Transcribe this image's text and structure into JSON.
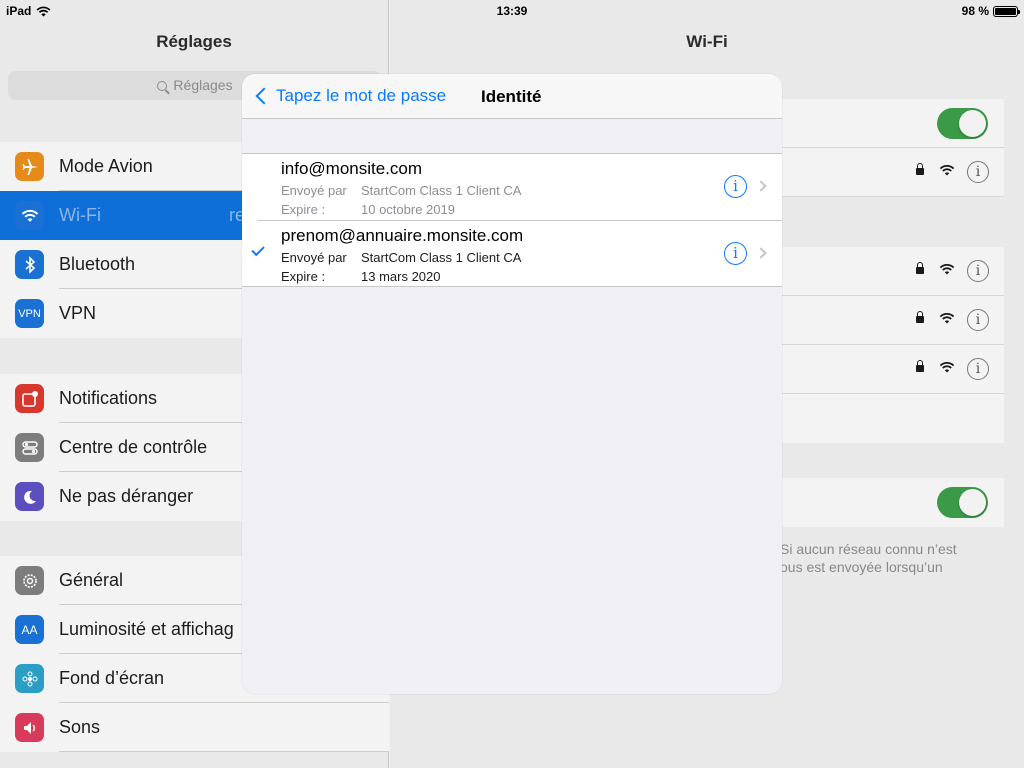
{
  "status": {
    "device": "iPad",
    "time": "13:39",
    "battery": "98 %",
    "battery_level": 0.98
  },
  "left": {
    "title": "Réglages",
    "search_placeholder": "Réglages",
    "groups": [
      [
        {
          "label": "Mode Avion",
          "icon": "airplane-icon",
          "color": "#e58b1a"
        },
        {
          "label": "Wi-Fi",
          "icon": "wifi-icon",
          "color": "#1b70d4",
          "value": "re",
          "selected": true
        },
        {
          "label": "Bluetooth",
          "icon": "bluetooth-icon",
          "color": "#1b70d4"
        },
        {
          "label": "VPN",
          "icon": "vpn-icon",
          "color": "#1b70d4",
          "icon_text": "VPN"
        }
      ],
      [
        {
          "label": "Notifications",
          "icon": "notifications-icon",
          "color": "#d8372e"
        },
        {
          "label": "Centre de contrôle",
          "icon": "control-center-icon",
          "color": "#7d7d7d"
        },
        {
          "label": "Ne pas déranger",
          "icon": "moon-icon",
          "color": "#5b4fbf"
        }
      ],
      [
        {
          "label": "Général",
          "icon": "gear-icon",
          "color": "#7d7d7d"
        },
        {
          "label": "Luminosité et affichag",
          "icon": "brightness-icon",
          "color": "#1b70d4",
          "icon_text": "AA"
        },
        {
          "label": "Fond d’écran",
          "icon": "wallpaper-icon",
          "color": "#2a9ec4"
        },
        {
          "label": "Sons",
          "icon": "sound-icon",
          "color": "#d83a5a"
        }
      ]
    ]
  },
  "right": {
    "title": "Wi-Fi",
    "footnote_line1": "Si aucun réseau connu n’est",
    "footnote_line2": "ous est envoyée lorsqu’un"
  },
  "modal": {
    "back_label": "Tapez le mot de passe",
    "title": "Identité",
    "certs": [
      {
        "name": "info@monsite.com",
        "issuer_key": "Envoyé par",
        "issuer": "StartCom Class 1 Client CA",
        "expires_key": "Expire :",
        "expires": "10 octobre 2019",
        "selected": false
      },
      {
        "name": "prenom@annuaire.monsite.com",
        "issuer_key": "Envoyé par",
        "issuer": "StartCom Class 1 Client CA",
        "expires_key": "Expire :",
        "expires": "13 mars 2020",
        "selected": true
      }
    ]
  },
  "colors": {
    "accent": "#0a7aff",
    "toggle_on": "#3a9a48"
  }
}
